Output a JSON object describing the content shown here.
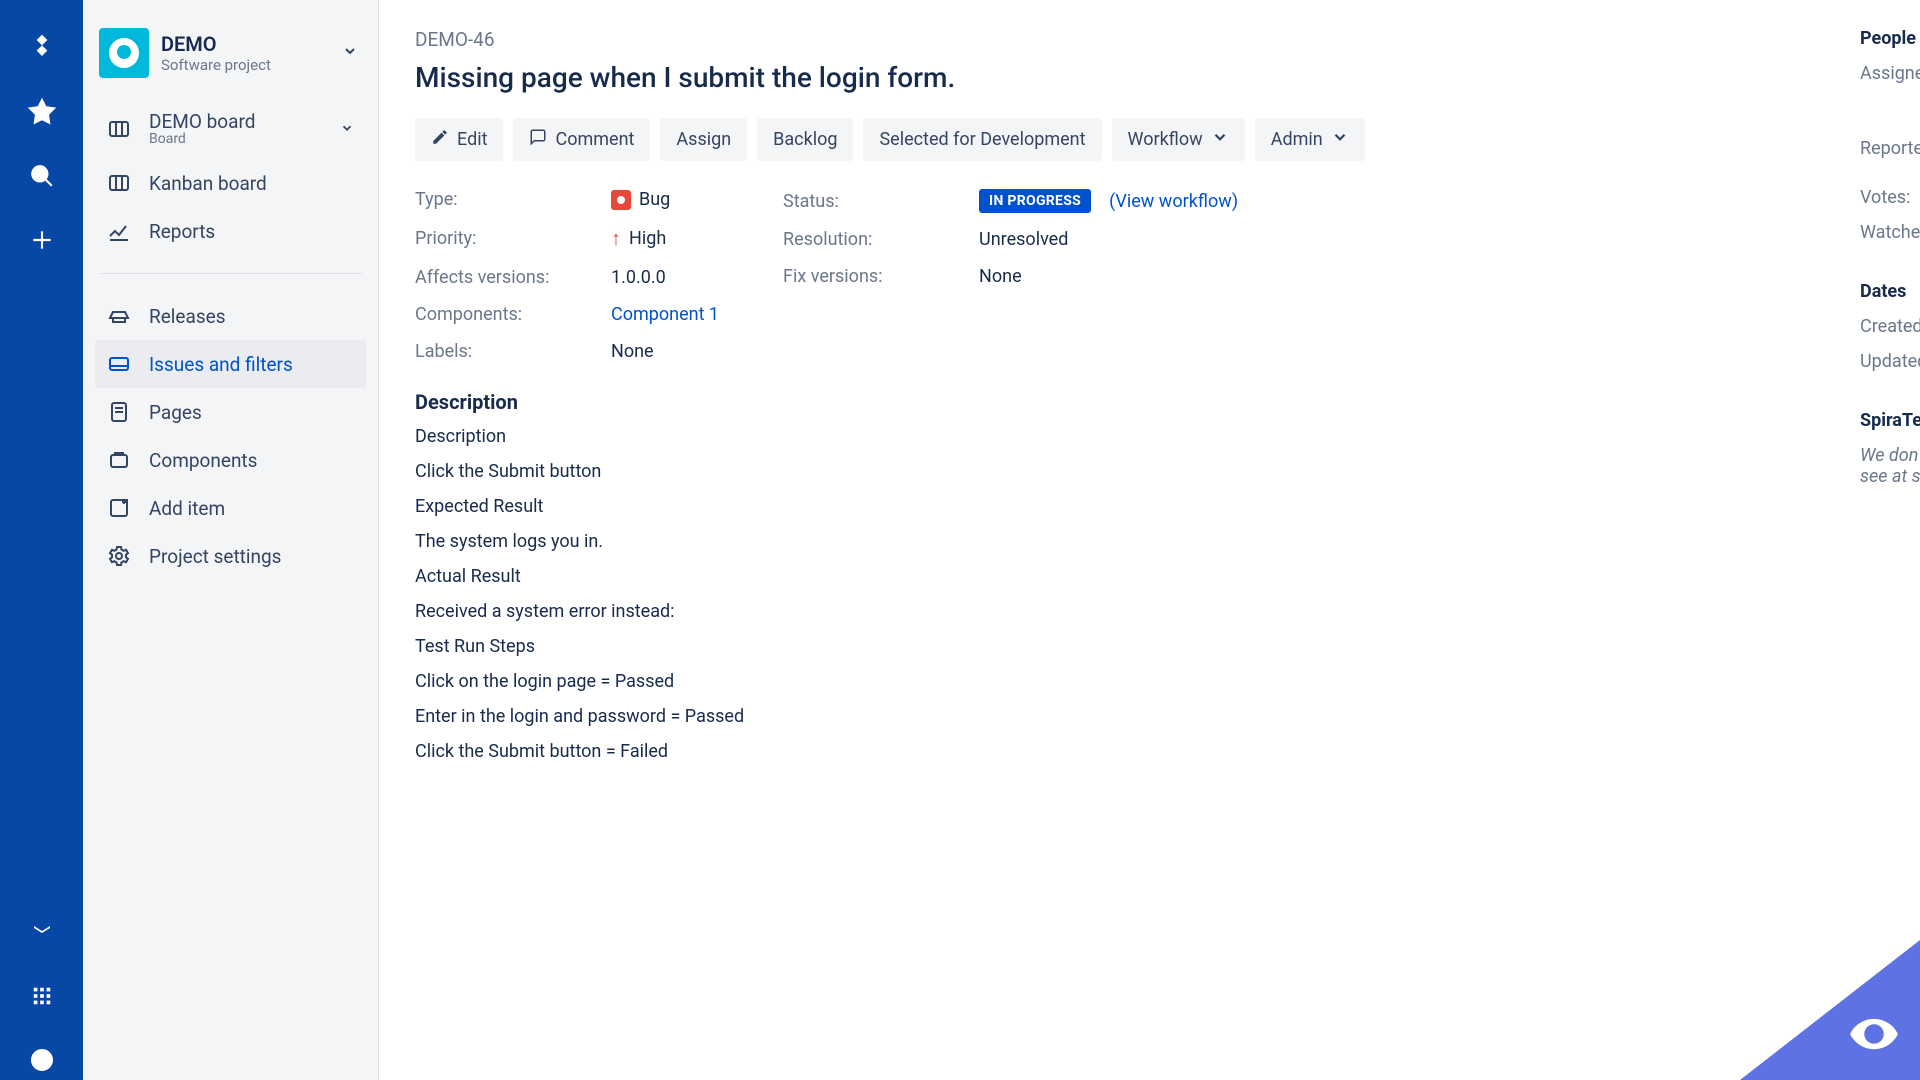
{
  "project": {
    "name": "DEMO",
    "subtitle": "Software project",
    "board": {
      "title": "DEMO board",
      "subtitle": "Board"
    },
    "nav": {
      "kanban": "Kanban board",
      "reports": "Reports",
      "releases": "Releases",
      "issues": "Issues and filters",
      "pages": "Pages",
      "components": "Components",
      "addItem": "Add item",
      "settings": "Project settings"
    }
  },
  "issue": {
    "key": "DEMO-46",
    "summary": "Missing page when I submit the login form.",
    "toolbar": {
      "edit": "Edit",
      "comment": "Comment",
      "assign": "Assign",
      "backlog": "Backlog",
      "selectedForDev": "Selected for Development",
      "workflow": "Workflow",
      "admin": "Admin"
    },
    "fields": {
      "type": {
        "label": "Type:",
        "value": "Bug"
      },
      "priority": {
        "label": "Priority:",
        "value": "High"
      },
      "affects": {
        "label": "Affects versions:",
        "value": "1.0.0.0"
      },
      "components": {
        "label": "Components:",
        "value": "Component 1"
      },
      "labels": {
        "label": "Labels:",
        "value": "None"
      },
      "status": {
        "label": "Status:",
        "value": "IN PROGRESS",
        "link": "View workflow"
      },
      "resolution": {
        "label": "Resolution:",
        "value": "Unresolved"
      },
      "fixVersions": {
        "label": "Fix versions:",
        "value": "None"
      }
    },
    "description": {
      "heading": "Description",
      "lines": [
        "Description",
        "Click the Submit button",
        "Expected Result",
        "The system logs you in.",
        "Actual Result",
        "Received a system error instead:",
        "Test Run Steps",
        "Click on the login page = Passed",
        "Enter in the login and password = Passed",
        "Click the Submit button = Failed"
      ]
    }
  },
  "rightPanel": {
    "people": "People",
    "assignee": "Assignee",
    "reporter": "Reporter",
    "votes": "Votes:",
    "watchers": "Watchers",
    "dates": "Dates",
    "created": "Created",
    "updated": "Updated",
    "spira": "SpiraTest",
    "spiraLine1": "We don",
    "spiraLine2": "see at s"
  }
}
